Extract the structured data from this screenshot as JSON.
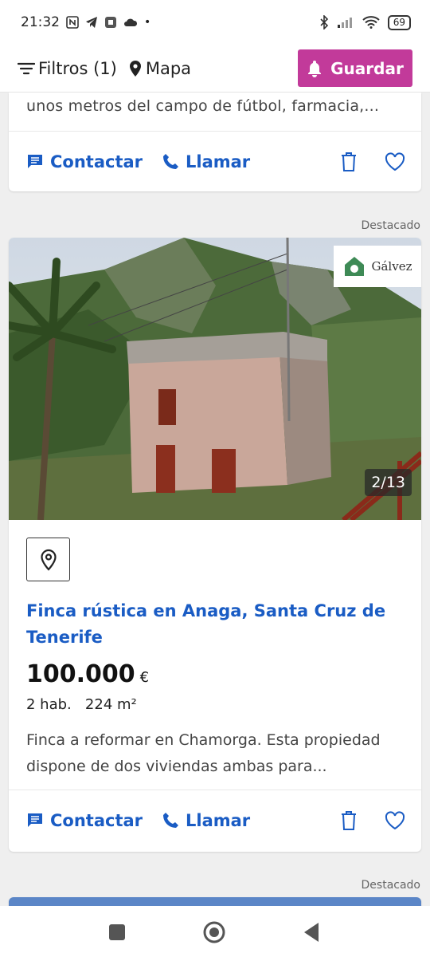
{
  "status_bar": {
    "time": "21:32",
    "battery": "69"
  },
  "top_bar": {
    "filters_label": "Filtros (1)",
    "map_label": "Mapa",
    "save_label": "Guardar",
    "save_color": "#c23a9a"
  },
  "listing_prev": {
    "snippet": "unos metros del campo de fútbol, farmacia,...",
    "contact_label": "Contactar",
    "call_label": "Llamar"
  },
  "featured_label": "Destacado",
  "listing": {
    "agency_name": "Gálvez",
    "photo_counter": "2/13",
    "title": "Finca rústica en Anaga, Santa Cruz de Tenerife",
    "price": "100.000",
    "currency": "€",
    "features": "2 hab.   224 m²",
    "description": "Finca a reformar en Chamorga. Esta propiedad dispone de dos viviendas ambas para...",
    "contact_label": "Contactar",
    "call_label": "Llamar"
  },
  "next_featured_label": "Destacado",
  "icons": [
    "filter-icon",
    "map-pin-icon",
    "bell-icon",
    "chat-icon",
    "phone-icon",
    "trash-icon",
    "heart-icon",
    "location-icon"
  ],
  "colors": {
    "link": "#1a5cc4",
    "accent": "#c23a9a"
  }
}
